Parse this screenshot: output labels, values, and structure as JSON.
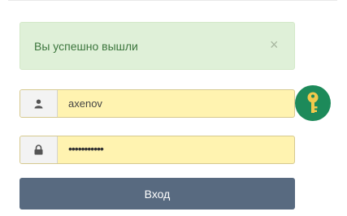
{
  "alert": {
    "message": "Вы успешно вышли",
    "close_symbol": "×"
  },
  "username": {
    "value": "axenov",
    "icon": "user-icon"
  },
  "password": {
    "masked_value": "•••••••••••",
    "icon": "lock-icon"
  },
  "login_button": {
    "label": "Вход"
  },
  "badge": {
    "icon": "key-icon"
  },
  "colors": {
    "alert_bg": "#dff0d8",
    "alert_text": "#3c763d",
    "field_bg": "#fff3b0",
    "button_bg": "#586a80",
    "badge_bg": "#1d8a5a",
    "key": "#f2c94c"
  }
}
